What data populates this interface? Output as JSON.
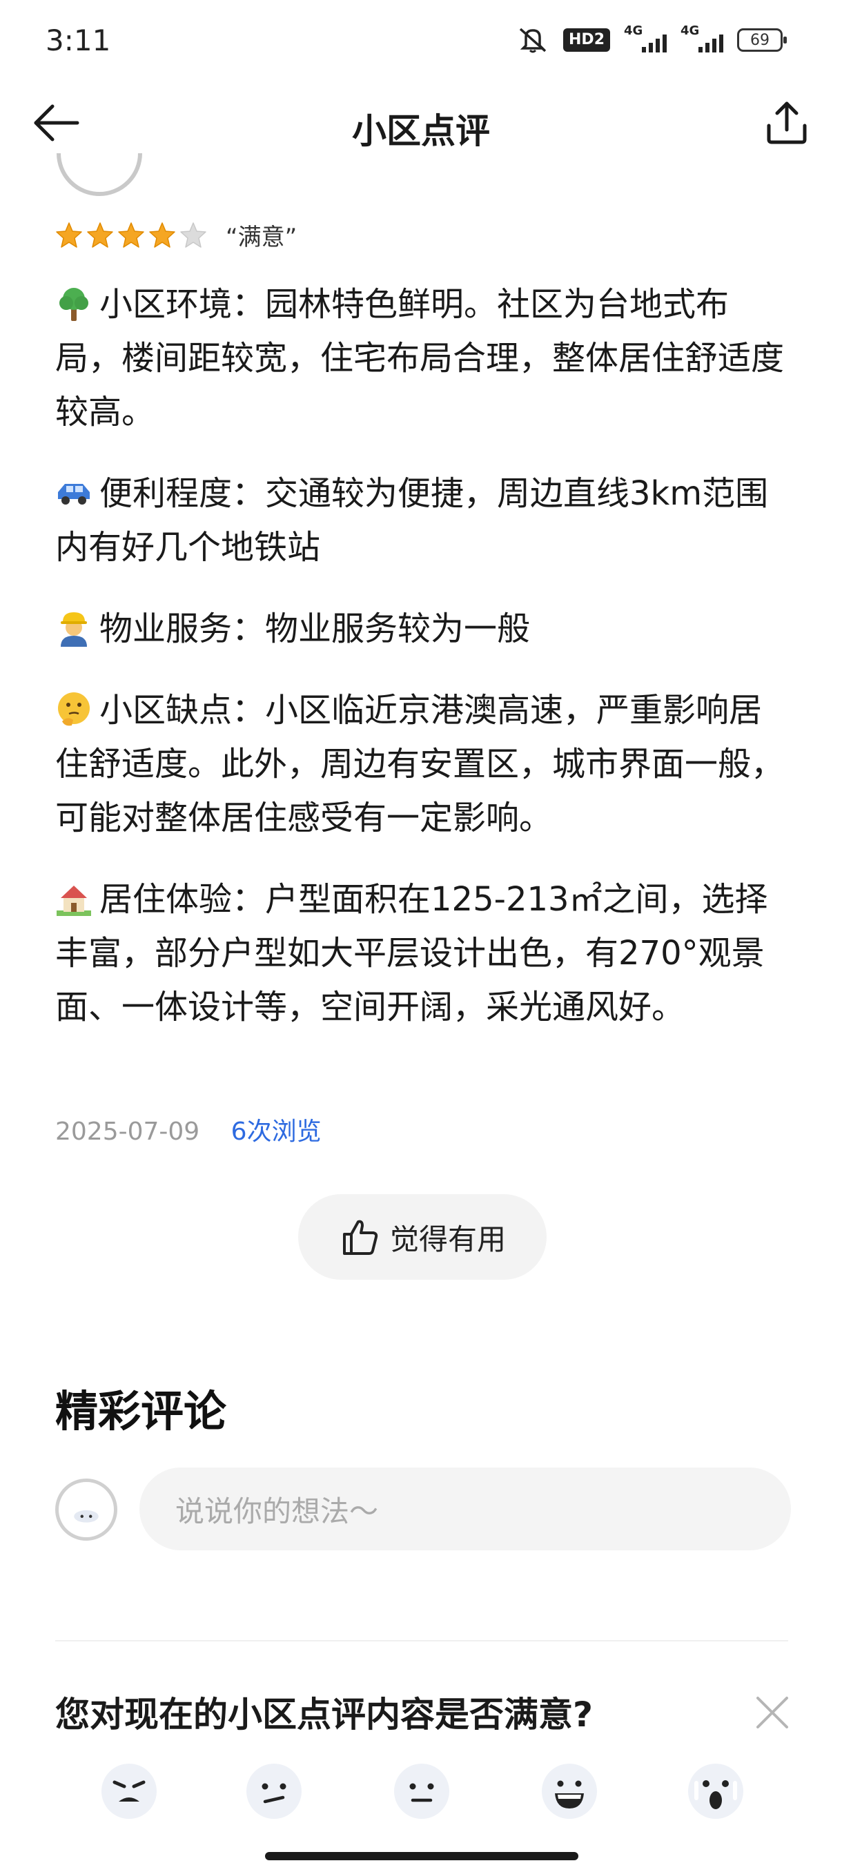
{
  "status_bar": {
    "time": "3:11",
    "hd_label": "HD2",
    "network_1": "4G",
    "network_2": "4G",
    "battery": "69"
  },
  "nav": {
    "title": "小区点评",
    "back_icon": "back-arrow-icon",
    "share_icon": "share-icon"
  },
  "review": {
    "rating": 4,
    "rating_max": 5,
    "rating_text": "“满意”",
    "paragraphs": [
      {
        "icon": "tree-emoji",
        "text": "小区环境：园林特色鲜明。社区为台地式布局，楼间距较宽，住宅布局合理，整体居住舒适度较高。"
      },
      {
        "icon": "car-emoji",
        "text": "便利程度：交通较为便捷，周边直线3km范围内有好几个地铁站"
      },
      {
        "icon": "worker-emoji",
        "text": "物业服务：物业服务较为一般"
      },
      {
        "icon": "thinking-face-emoji",
        "text": "小区缺点：小区临近京港澳高速，严重影响居住舒适度。此外，周边有安置区，城市界面一般，可能对整体居住感受有一定影响。"
      },
      {
        "icon": "house-emoji",
        "text": "居住体验：户型面积在125-213㎡之间，选择丰富，部分户型如大平层设计出色，有270°观景面、一体设计等，空间开阔，采光通风好。"
      }
    ],
    "date": "2025-07-09",
    "views": "6次浏览",
    "useful_label": "觉得有用"
  },
  "comments": {
    "title": "精彩评论",
    "placeholder": "说说你的想法～"
  },
  "survey": {
    "question": "您对现在的小区点评内容是否满意?",
    "faces": [
      "angry-face-icon",
      "unhappy-face-icon",
      "neutral-face-icon",
      "happy-face-icon",
      "surprised-face-icon"
    ]
  },
  "colors": {
    "star": "#f5a623",
    "link": "#2d6ae0",
    "muted": "#9a9a9a"
  }
}
